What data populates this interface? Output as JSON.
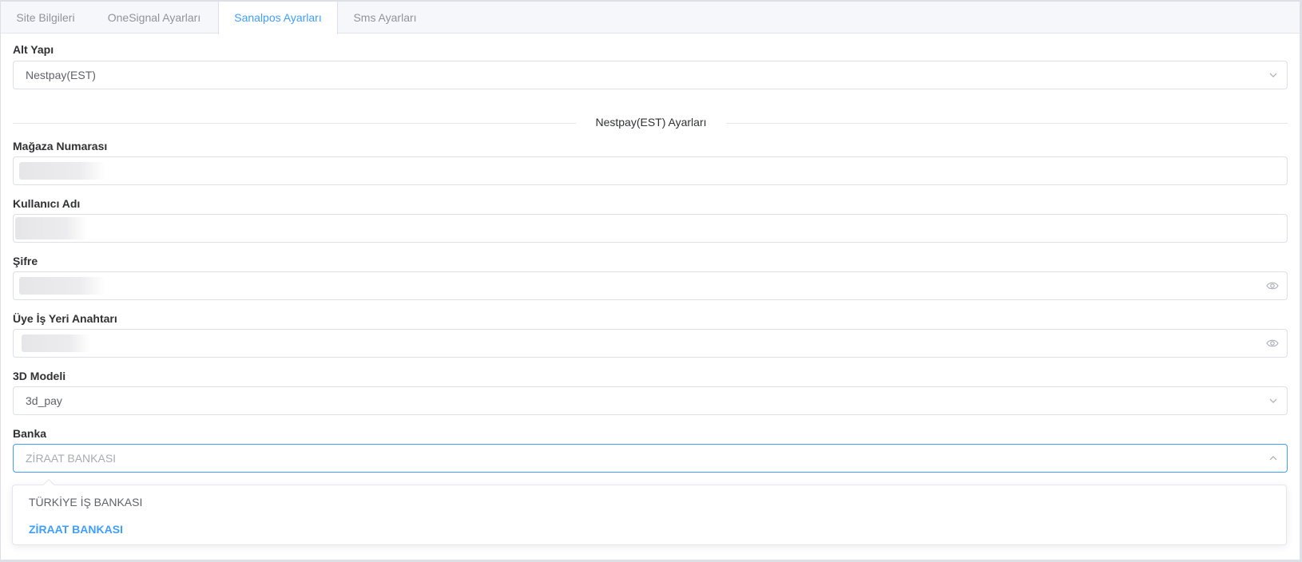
{
  "tabs": [
    {
      "label": "Site Bilgileri"
    },
    {
      "label": "OneSignal Ayarları"
    },
    {
      "label": "Sanalpos Ayarları"
    },
    {
      "label": "Sms Ayarları"
    }
  ],
  "active_tab": "Sanalpos Ayarları",
  "form": {
    "alt_yapi": {
      "label": "Alt Yapı",
      "value": "Nestpay(EST)"
    },
    "section_title": "Nestpay(EST) Ayarları",
    "magaza": {
      "label": "Mağaza Numarası",
      "value": ""
    },
    "kullanici": {
      "label": "Kullanıcı Adı",
      "value": ""
    },
    "sifre": {
      "label": "Şifre",
      "value": ""
    },
    "anahtar": {
      "label": "Üye İş Yeri Anahtarı",
      "value": ""
    },
    "model": {
      "label": "3D Modeli",
      "value": "3d_pay"
    },
    "banka": {
      "label": "Banka",
      "placeholder": "ZİRAAT BANKASI"
    }
  },
  "dropdown": {
    "options": [
      "TÜRKİYE İŞ BANKASI",
      "ZİRAAT BANKASI"
    ],
    "selected": "ZİRAAT BANKASI"
  },
  "colors": {
    "accent": "#409eff",
    "border": "#dcdfe6",
    "label": "#303133",
    "text": "#606266"
  },
  "icons": {
    "select": "chevron-down-icon",
    "open_select": "chevron-up-icon",
    "password": "eye-icon"
  }
}
